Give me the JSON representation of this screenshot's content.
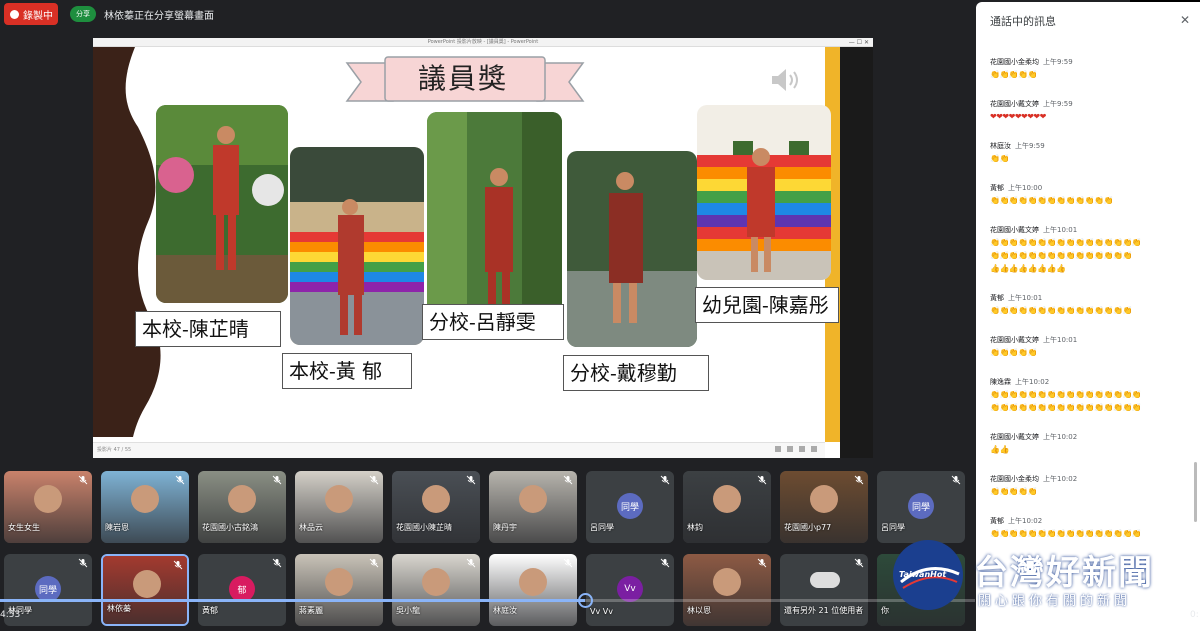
{
  "top_bar": {
    "recording_label": "錄製中",
    "present_badge": "分享",
    "present_text": "林依蓁正在分享螢幕畫面"
  },
  "slide": {
    "titlebar_text": "PowerPoint 投影片放映 - [議員獎] - PowerPoint",
    "title": "議員獎",
    "status_text": "投影片 47 / 55",
    "captions": [
      "本校-陳芷晴",
      "本校-黃 郁",
      "分校-呂靜雯",
      "分校-戴穆勤",
      "幼兒園-陳嘉彤"
    ],
    "colors": {
      "banner": "#f7d5d5",
      "banner_border": "#9aa0a6",
      "accent_strip": "#f0b429",
      "wave": "#3b2218"
    }
  },
  "chat": {
    "title": "通話中的訊息",
    "close_icon": "close-icon",
    "messages": [
      {
        "sender": "花園國小金柔均",
        "time": "上午9:59",
        "lines": [
          "👏👏👏👏👏"
        ],
        "kind": "clap"
      },
      {
        "sender": "花園國小戴文婷",
        "time": "上午9:59",
        "lines": [
          "❤❤❤❤❤❤❤❤❤"
        ],
        "kind": "red"
      },
      {
        "sender": "林庭汝",
        "time": "上午9:59",
        "lines": [
          "👏👏"
        ],
        "kind": "clap"
      },
      {
        "sender": "黃郁",
        "time": "上午10:00",
        "lines": [
          "👏👏👏👏👏👏👏👏👏👏👏👏👏"
        ],
        "kind": "clap"
      },
      {
        "sender": "花園國小戴文婷",
        "time": "上午10:01",
        "lines": [
          "👏👏👏👏👏👏👏👏👏👏👏👏👏👏👏👏",
          "👏👏👏👏👏👏👏👏👏👏👏👏👏👏👏",
          "👍👍👍👍👍👍👍👍"
        ],
        "kind": "clap"
      },
      {
        "sender": "黃郁",
        "time": "上午10:01",
        "lines": [
          "👏👏👏👏👏👏👏👏👏👏👏👏👏👏👏"
        ],
        "kind": "clap"
      },
      {
        "sender": "花園國小戴文婷",
        "time": "上午10:01",
        "lines": [
          "👏👏👏👏👏"
        ],
        "kind": "clap"
      },
      {
        "sender": "陳逸霖",
        "time": "上午10:02",
        "lines": [
          "👏👏👏👏👏👏👏👏👏👏👏👏👏👏👏👏",
          "👏👏👏👏👏👏👏👏👏👏👏👏👏👏👏👏"
        ],
        "kind": "clap"
      },
      {
        "sender": "花園國小戴文婷",
        "time": "上午10:02",
        "lines": [
          "👍👍"
        ],
        "kind": "clap"
      },
      {
        "sender": "花園國小金柔均",
        "time": "上午10:02",
        "lines": [
          "👏👏👏👏👏"
        ],
        "kind": "clap"
      },
      {
        "sender": "黃郁",
        "time": "上午10:02",
        "lines": [
          "👏👏👏👏👏👏👏👏👏👏👏👏👏👏👏👏"
        ],
        "kind": "clap"
      }
    ]
  },
  "participants_row1": [
    {
      "name": "女生女生",
      "type": "photo",
      "color": "#c9826b"
    },
    {
      "name": "陳岩恩",
      "type": "photo",
      "color": "#7fb3d5"
    },
    {
      "name": "花園國小古銘鴻",
      "type": "photo",
      "color": "#8a8f84"
    },
    {
      "name": "林品云",
      "type": "photo",
      "color": "#d4d0c8"
    },
    {
      "name": "花園國小陳芷晴",
      "type": "photo",
      "color": "#4a4f55"
    },
    {
      "name": "陳丹宇",
      "type": "photo",
      "color": "#b7b4ad"
    },
    {
      "name": "呂同學",
      "type": "avatar",
      "initial": "同學",
      "color": "#5c6bc0"
    },
    {
      "name": "林鈞",
      "type": "photo",
      "color": "#3c4043"
    },
    {
      "name": "花園國小p77",
      "type": "photo",
      "color": "#6d4c31"
    },
    {
      "name": "呂同學",
      "type": "avatar",
      "initial": "同學",
      "color": "#5c6bc0"
    }
  ],
  "participants_row2": [
    {
      "name": "林同學",
      "type": "avatar",
      "initial": "同學",
      "color": "#5c6bc0"
    },
    {
      "name": "林依蓁",
      "type": "photo",
      "color": "#a33a2f",
      "selected": true
    },
    {
      "name": "黃郁",
      "type": "avatar",
      "initial": "郁",
      "color": "#d81b60"
    },
    {
      "name": "蔣素麗",
      "type": "photo",
      "color": "#c9c3b8"
    },
    {
      "name": "吳小龍",
      "type": "photo",
      "color": "#d9d6cf"
    },
    {
      "name": "林庭汝",
      "type": "photo",
      "color": "#ffffff"
    },
    {
      "name": "Vv Vv",
      "type": "avatar",
      "initial": "Vv",
      "color": "#7b1fa2"
    },
    {
      "name": "林以恩",
      "type": "photo",
      "color": "#8d5a44"
    },
    {
      "name": "還有另外 21 位使用者",
      "type": "more",
      "color": "#3c4043"
    },
    {
      "name": "你",
      "type": "photo",
      "color": "#2d4a3a"
    }
  ],
  "player": {
    "progress": 0.6,
    "time_elapsed": "4:53",
    "time_total": "0:"
  },
  "watermark": {
    "logo_text": "TaiwanHot",
    "title": "台灣好新聞",
    "subtitle": "關心跟你有關的新聞"
  }
}
